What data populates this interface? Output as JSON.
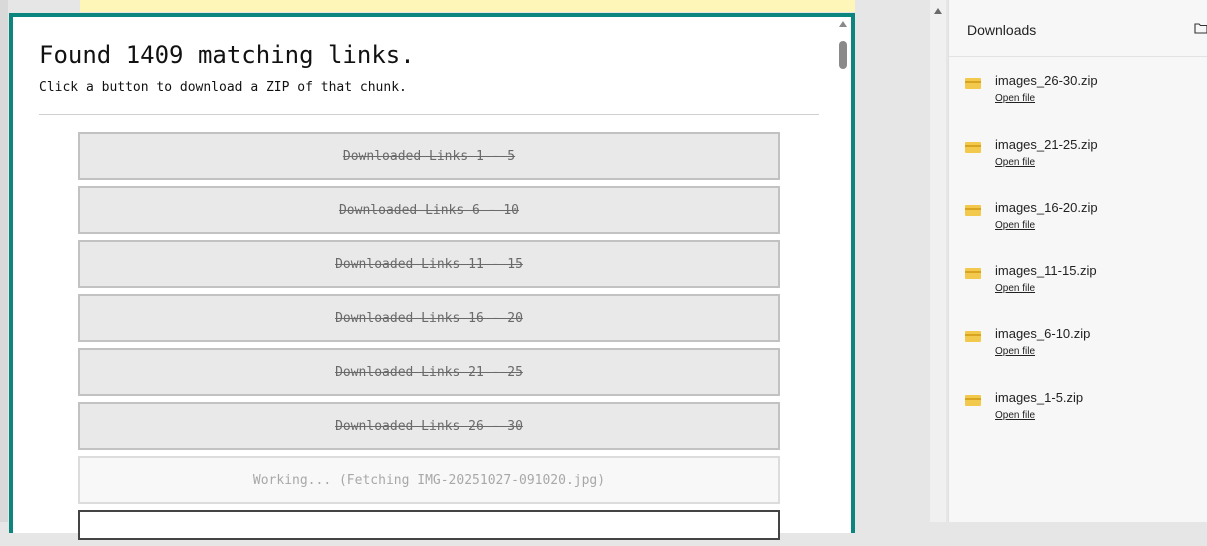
{
  "dialog": {
    "title": "Found 1409 matching links.",
    "subtitle": "Click a button to download a ZIP of that chunk.",
    "chunks": [
      {
        "label": "Downloaded Links 1 - 5"
      },
      {
        "label": "Downloaded Links 6 - 10"
      },
      {
        "label": "Downloaded Links 11 - 15"
      },
      {
        "label": "Downloaded Links 16 - 20"
      },
      {
        "label": "Downloaded Links 21 - 25"
      },
      {
        "label": "Downloaded Links 26 - 30"
      }
    ],
    "working_label": "Working... (Fetching IMG-20251027-091020.jpg)"
  },
  "downloads": {
    "title": "Downloads",
    "open_file_label": "Open file",
    "items": [
      {
        "name": "images_26-30.zip",
        "action": "Open file"
      },
      {
        "name": "images_21-25.zip",
        "action": "Open file"
      },
      {
        "name": "images_16-20.zip",
        "action": "Open file"
      },
      {
        "name": "images_11-15.zip",
        "action": "Open file"
      },
      {
        "name": "images_6-10.zip",
        "action": "Open file"
      },
      {
        "name": "images_1-5.zip",
        "action": "Open file"
      }
    ]
  },
  "colors": {
    "accent": "#0d857f",
    "banner": "#fdf6b8",
    "folder": "#f2c94c"
  },
  "icons": [
    "folder-icon",
    "zip-file-icon",
    "scroll-up-arrow-icon"
  ]
}
